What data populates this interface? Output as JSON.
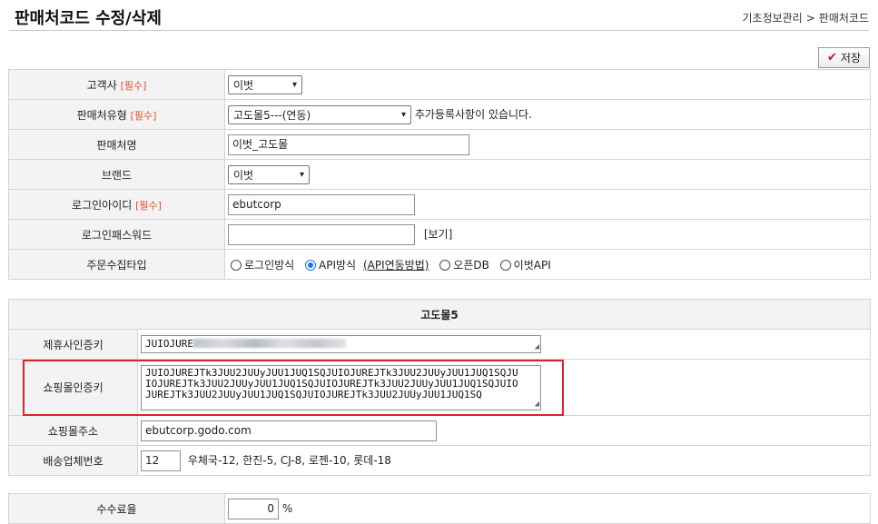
{
  "header": {
    "title": "판매처코드 수정/삭제",
    "breadcrumb": [
      "기초정보관리",
      ">",
      "판매처코드"
    ]
  },
  "toolbar": {
    "save_label": "저장",
    "save_icon": "check-icon"
  },
  "required_tag": "[필수]",
  "form": {
    "customer": {
      "label": "고객사",
      "value": "이벗"
    },
    "channel_type": {
      "label": "판매처유형",
      "value": "고도몰5---(연동)",
      "note": "추가등록사항이 있습니다."
    },
    "channel_name": {
      "label": "판매처명",
      "value": "이벗_고도몰"
    },
    "brand": {
      "label": "브랜드",
      "value": "이벗"
    },
    "login_id": {
      "label": "로그인아이디",
      "value": "ebutcorp"
    },
    "login_pw": {
      "label": "로그인패스워드",
      "value": "",
      "view_link": "[보기]"
    },
    "order_collect": {
      "label": "주문수집타입",
      "options": [
        "로그인방식",
        "API방식",
        "오픈DB",
        "이벗API"
      ],
      "selected": "API방식",
      "help_link": "(API연동방법)"
    }
  },
  "godo": {
    "section_title": "고도몰5",
    "partner_key": {
      "label": "제휴사인증키",
      "value_prefix": "JUIOJURE"
    },
    "shop_key": {
      "label": "쇼핑몰인증키",
      "lines": [
        "JUIOJUREJTk3JUU2JUUyJUU1JUQ1SQJUIOJUREJTk3JUU2JUUyJUU1JUQ1SQJU",
        "IOJUREJTk3JUU2JUUyJUU1JUQ1SQJUIOJUREJTk3JUU2JUUyJUU1JUQ1SQJUIO",
        "JUREJTk3JUU2JUUyJUU1JUQ1SQJUIOJUREJTk3JUU2JUUyJUU1JUQ1SQ"
      ]
    },
    "shop_address": {
      "label": "쇼핑몰주소",
      "value": "ebutcorp.godo.com"
    },
    "carrier_no": {
      "label": "배송업체번호",
      "value": "12",
      "hint": "우체국-12, 한진-5, CJ-8, 로젠-10, 롯데-18"
    }
  },
  "fee": {
    "label": "수수료율",
    "value": "0",
    "unit": "%"
  },
  "colors": {
    "accent": "#d9262c",
    "label_bg": "#f3f3f3",
    "border": "#d4d4d4",
    "radio": "#1a73e8"
  }
}
